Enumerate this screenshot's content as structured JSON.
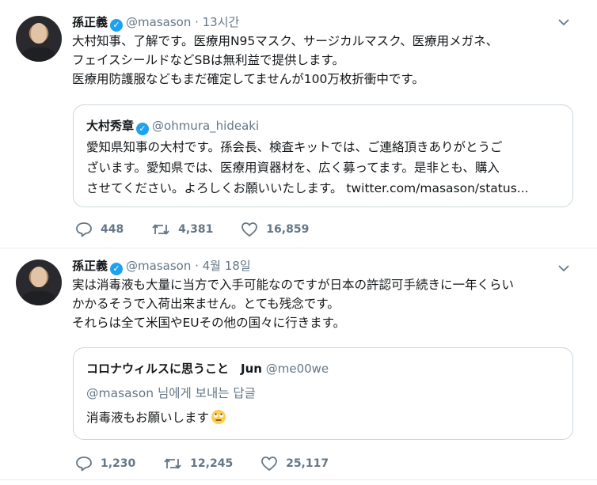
{
  "tweets": [
    {
      "name": "孫正義",
      "handle": "@masason",
      "time": "13시간",
      "lines": [
        "大村知事、了解です。医療用N95マスク、サージカルマスク、医療用メガネ、",
        "フェイスシールドなどSBは無利益で提供します。",
        "医療用防護服などもまだ確定してませんが100万枚折衝中です。"
      ],
      "quote": {
        "name": "大村秀章",
        "handle": "@ohmura_hideaki",
        "lines": [
          "愛知県知事の大村です。孫会長、検査キットでは、ご連絡頂きありがとうご",
          "ざいます。愛知県では、医療用資器材を、広く募ってます。是非とも、購入",
          "させてください。よろしくお願いいたします。 twitter.com/masason/status..."
        ]
      },
      "replies": "448",
      "retweets": "4,381",
      "likes": "16,859"
    },
    {
      "name": "孫正義",
      "handle": "@masason",
      "time": "4월 18일",
      "lines": [
        "実は消毒液も大量に当方で入手可能なのですが日本の許認可手続きに一年くらい",
        "かかるそうで入荷出来ません。とても残念です。",
        "それらは全て米国やEUその他の国々に行きます。"
      ],
      "quote": {
        "name": "コロナウィルスに思うこと　Jun",
        "handle": "@me00we",
        "reply_to": "@masason 님에게 보내는 답글",
        "text": "消毒液もお願いします"
      },
      "replies": "1,230",
      "retweets": "12,245",
      "likes": "25,117"
    }
  ],
  "icons": {
    "verified": "verified-badge-icon",
    "chevron": "chevron-down-icon",
    "reply": "reply-icon",
    "retweet": "retweet-icon",
    "like": "heart-icon",
    "emoji": "face-with-rolling-eyes-emoji"
  },
  "colors": {
    "accent": "#1da1f2",
    "muted": "#657786",
    "border": "#e6ecf0"
  }
}
